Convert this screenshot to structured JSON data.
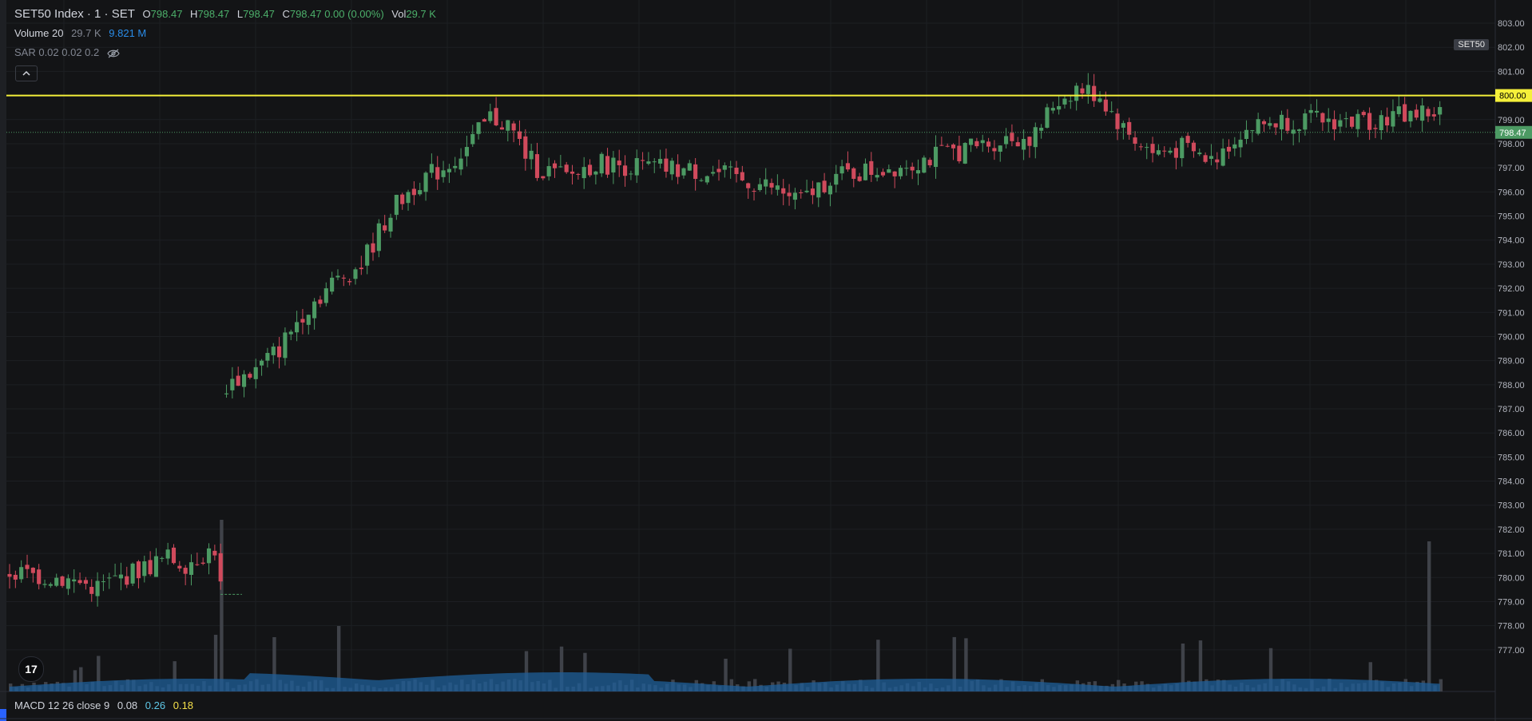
{
  "header": {
    "symbol": "SET50 Index · 1 · SET",
    "o_label": "O",
    "o_value": "798.47",
    "h_label": "H",
    "h_value": "798.47",
    "l_label": "L",
    "l_value": "798.47",
    "c_label": "C",
    "c_value": "798.47 0.00 (0.00%)",
    "vol_label": "Vol",
    "vol_value": "29.7 K"
  },
  "volume_legend": {
    "name": "Volume 20",
    "value1": "29.7 K",
    "value2": "9.821 M"
  },
  "sar_legend": {
    "text": "SAR 0.02 0.02 0.2"
  },
  "symbol_tag": "SET50",
  "logo_text": "17",
  "macd_legend": {
    "name": "MACD 12 26 close 9",
    "v1": "0.08",
    "v2": "0.26",
    "v3": "0.18"
  },
  "colors": {
    "up": "#4c9a63",
    "down": "#d04a5c",
    "hline": "#f5f03a",
    "price_tag": "#4c9a63",
    "volume_area": "#1f5f99",
    "volume_bar": "#3f4249",
    "background": "#131416"
  },
  "chart_data": {
    "type": "candlestick",
    "y_ticks": [
      "803.00",
      "802.00",
      "801.00",
      "800.00",
      "799.00",
      "798.00",
      "797.00",
      "796.00",
      "795.00",
      "794.00",
      "793.00",
      "792.00",
      "791.00",
      "790.00",
      "789.00",
      "788.00",
      "787.00",
      "786.00",
      "785.00",
      "784.00",
      "783.00",
      "782.00",
      "781.00",
      "780.00",
      "779.00",
      "778.00",
      "777.00"
    ],
    "ylim": [
      776.2,
      803.3
    ],
    "horizontal_line": {
      "value": 800.0,
      "label": "800.00"
    },
    "last_price": {
      "value": 798.47,
      "label": "798.47"
    },
    "candle_count": 245,
    "close_path": [
      [
        0,
        780.2
      ],
      [
        8,
        780.0
      ],
      [
        15,
        779.6
      ],
      [
        22,
        780.3
      ],
      [
        27,
        780.8
      ],
      [
        30,
        780.6
      ],
      [
        35,
        781.2
      ],
      [
        36,
        779.6
      ],
      [
        37,
        788.0
      ],
      [
        42,
        788.6
      ],
      [
        46,
        789.5
      ],
      [
        50,
        791.0
      ],
      [
        55,
        792.2
      ],
      [
        60,
        793.0
      ],
      [
        65,
        795.2
      ],
      [
        70,
        796.5
      ],
      [
        74,
        797.0
      ],
      [
        78,
        797.8
      ],
      [
        82,
        799.1
      ],
      [
        85,
        798.8
      ],
      [
        88,
        797.6
      ],
      [
        90,
        797.0
      ],
      [
        95,
        796.6
      ],
      [
        100,
        797.2
      ],
      [
        110,
        797.0
      ],
      [
        120,
        796.8
      ],
      [
        130,
        796.2
      ],
      [
        135,
        795.6
      ],
      [
        140,
        796.6
      ],
      [
        150,
        797.0
      ],
      [
        160,
        797.6
      ],
      [
        170,
        798.2
      ],
      [
        175,
        798.3
      ],
      [
        178,
        799.6
      ],
      [
        182,
        800.3
      ],
      [
        186,
        800.0
      ],
      [
        190,
        798.6
      ],
      [
        195,
        797.6
      ],
      [
        200,
        797.8
      ],
      [
        205,
        797.3
      ],
      [
        210,
        798.5
      ],
      [
        215,
        798.9
      ],
      [
        220,
        799.0
      ],
      [
        230,
        798.9
      ],
      [
        240,
        799.3
      ],
      [
        250,
        799.2
      ],
      [
        258,
        798.8
      ],
      [
        262,
        799.4
      ],
      [
        266,
        798.6
      ],
      [
        272,
        797.6
      ],
      [
        280,
        798.3
      ],
      [
        285,
        798.7
      ],
      [
        295,
        797.6
      ],
      [
        305,
        797.3
      ],
      [
        315,
        797.4
      ],
      [
        325,
        797.2
      ],
      [
        335,
        797.6
      ],
      [
        345,
        797.6
      ],
      [
        355,
        797.3
      ],
      [
        365,
        797.8
      ],
      [
        375,
        798.3
      ]
    ],
    "volume_avg_level": 0.5
  }
}
